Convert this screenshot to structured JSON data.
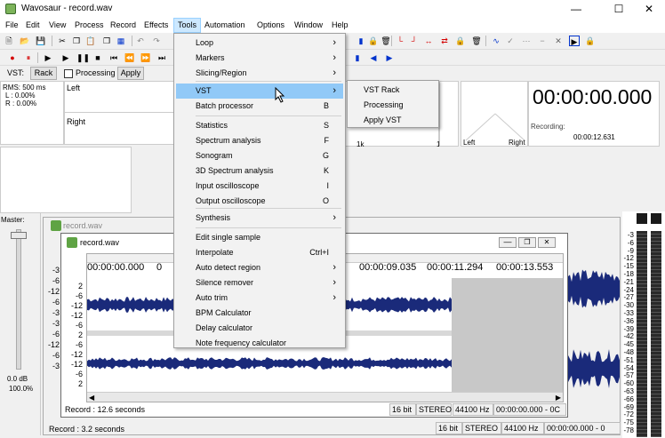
{
  "window": {
    "title": "Wavosaur - record.wav"
  },
  "menubar": [
    "File",
    "Edit",
    "View",
    "Process",
    "Record",
    "Effects",
    "Tools",
    "Automation",
    "Options",
    "Window",
    "Help"
  ],
  "vstbar": {
    "label": "VST:",
    "rack": "Rack",
    "processing": "Processing",
    "apply": "Apply"
  },
  "rms": {
    "rms": "RMS: 500 ms",
    "l": "L : 0.00%",
    "r": "R : 0.00%"
  },
  "channels": {
    "left": "Left",
    "right": "Right"
  },
  "spectrum": {
    "tick1k": "1k",
    "tick10k": "10k"
  },
  "vector": {
    "left": "Left",
    "right": "Right"
  },
  "time": {
    "big": "00:00:00.000",
    "recording_label": "Recording:",
    "recording_value": "00:00:12.631"
  },
  "master": {
    "label": "Master:",
    "db": "0.0 dB",
    "pct": "100.0%"
  },
  "backwin": {
    "title": "record.wav",
    "status": "Record : 3.2 seconds",
    "bits": "16 bit",
    "stereo": "STEREO",
    "rate": "44100 Hz",
    "range": "00:00:00.000 - 0"
  },
  "frontwin": {
    "title": "record.wav",
    "timecodes": [
      "00:00:00.000",
      "0",
      "00:00:09.035",
      "00:00:11.294",
      "00:00:13.553"
    ],
    "status": "Record : 12.6 seconds",
    "bits": "16 bit",
    "stereo": "STEREO",
    "rate": "44100 Hz",
    "range": "00:00:00.000 - 0C"
  },
  "dbscale_left": [
    "-3",
    "-6",
    "-12",
    "-6",
    "-3",
    "-3",
    "-6",
    "-12",
    "-6",
    "-3"
  ],
  "dbscale_front": [
    "2",
    "-6",
    "-12",
    "-12",
    "-6",
    "2",
    "-6",
    "-12",
    "-12",
    "-6",
    "2"
  ],
  "vu_scale": [
    "-3",
    "-6",
    "-9",
    "-12",
    "-15",
    "-18",
    "-21",
    "-24",
    "-27",
    "-30",
    "-33",
    "-36",
    "-39",
    "-42",
    "-45",
    "-48",
    "-51",
    "-54",
    "-57",
    "-60",
    "-63",
    "-66",
    "-69",
    "-72",
    "-75",
    "-78"
  ],
  "tools_menu": {
    "items": [
      {
        "label": "Loop",
        "sc": "",
        "arrow": true
      },
      {
        "label": "Markers",
        "sc": "",
        "arrow": true
      },
      {
        "label": "Slicing/Region",
        "sc": "",
        "arrow": true
      },
      {
        "label": "VST",
        "sc": "",
        "arrow": true
      },
      {
        "label": "Batch processor",
        "sc": "B",
        "arrow": false
      },
      {
        "label": "Statistics",
        "sc": "S",
        "arrow": false
      },
      {
        "label": "Spectrum analysis",
        "sc": "F",
        "arrow": false
      },
      {
        "label": "Sonogram",
        "sc": "G",
        "arrow": false
      },
      {
        "label": "3D Spectrum analysis",
        "sc": "K",
        "arrow": false
      },
      {
        "label": "Input oscilloscope",
        "sc": "I",
        "arrow": false
      },
      {
        "label": "Output oscilloscope",
        "sc": "O",
        "arrow": false
      },
      {
        "label": "Synthesis",
        "sc": "",
        "arrow": true
      },
      {
        "label": "Edit single sample",
        "sc": "",
        "arrow": false
      },
      {
        "label": "Interpolate",
        "sc": "Ctrl+I",
        "arrow": false
      },
      {
        "label": "Auto detect region",
        "sc": "",
        "arrow": true
      },
      {
        "label": "Silence remover",
        "sc": "",
        "arrow": true
      },
      {
        "label": "Auto trim",
        "sc": "",
        "arrow": true
      },
      {
        "label": "BPM Calculator",
        "sc": "",
        "arrow": false
      },
      {
        "label": "Delay calculator",
        "sc": "",
        "arrow": false
      },
      {
        "label": "Note frequency calculator",
        "sc": "",
        "arrow": false
      }
    ]
  },
  "vst_menu": [
    "VST Rack",
    "Processing",
    "Apply VST"
  ],
  "colors": {
    "wave": "#1a2a7a",
    "menu_highlight": "#91c9f7",
    "selection_gray": "#c8c8c8",
    "tb_red": "#d40000",
    "tb_blue": "#0033cc"
  }
}
